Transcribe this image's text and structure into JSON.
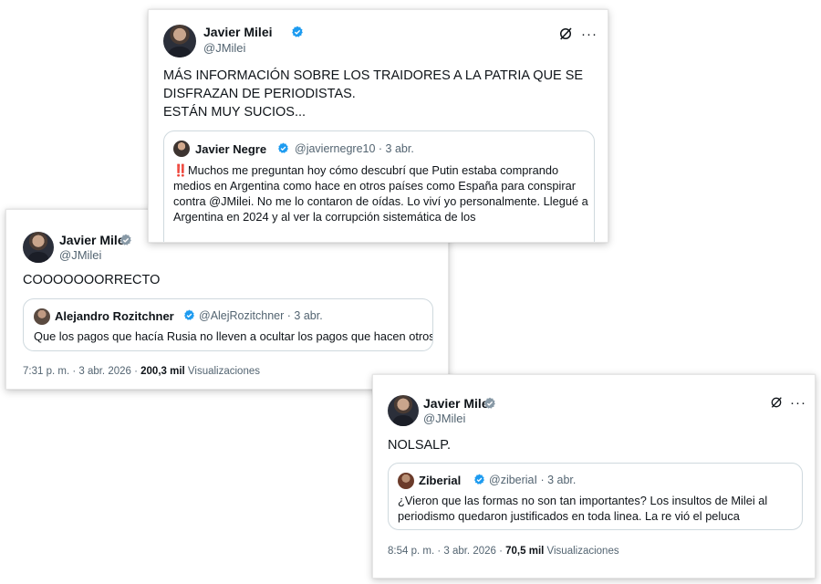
{
  "colors": {
    "verified": "#1d9bf0",
    "secondary_text": "#536471",
    "border": "#cfd9de",
    "alert": "#e0245e"
  },
  "tweet1": {
    "author_name": "Javier Milei",
    "author_handle": "@JMilei",
    "icons": [
      "verified-badge-icon",
      "grok-icon",
      "more-icon"
    ],
    "more_label": "···",
    "text_lines": [
      "MÁS INFORMACIÓN SOBRE LOS TRAIDORES A LA PATRIA QUE SE",
      "DISFRAZAN DE PERIODISTAS.",
      "ESTÁN MUY SUCIOS..."
    ],
    "quote": {
      "author_name": "Javier Negre",
      "handle_date": "@javiernegre10 · 3 abr.",
      "emoji": "‼️",
      "text_lines": [
        "Muchos me preguntan hoy cómo descubrí que Putin estaba comprando",
        "medios en Argentina como hace en otros países como España para conspirar",
        "contra @JMilei. No me lo contaron de oídas. Lo viví yo personalmente. Llegué a",
        "Argentina en 2024 y al ver la corrupción sistemática de los"
      ]
    }
  },
  "tweet2": {
    "author_name": "Javier Milei",
    "author_handle": "@JMilei",
    "text": "COOOOOOORRECTO",
    "quote": {
      "author_name": "Alejandro Rozitchner",
      "handle_date": "@AlejRozitchner · 3 abr.",
      "text": "Que los pagos que hacía Rusia no lleven a ocultar los pagos que hacen otros."
    },
    "footer": {
      "time": "7:31 p. m. · 3 abr. 2026 · ",
      "views": "200,3 mil",
      "views_label": " Visualizaciones"
    }
  },
  "tweet3": {
    "author_name": "Javier Milei",
    "author_handle": "@JMilei",
    "more_label": "···",
    "text": "NOLSALP.",
    "quote": {
      "author_name": "Ziberial",
      "handle_date": "@ziberiaI · 3 abr.",
      "text_lines": [
        "¿Vieron que las formas no son tan importantes? Los insultos de Milei al",
        "periodismo quedaron justificados en toda linea. La re vió el peluca"
      ]
    },
    "footer": {
      "time": "8:54 p. m. · 3 abr. 2026 · ",
      "views": "70,5 mil",
      "views_label": " Visualizaciones"
    }
  }
}
